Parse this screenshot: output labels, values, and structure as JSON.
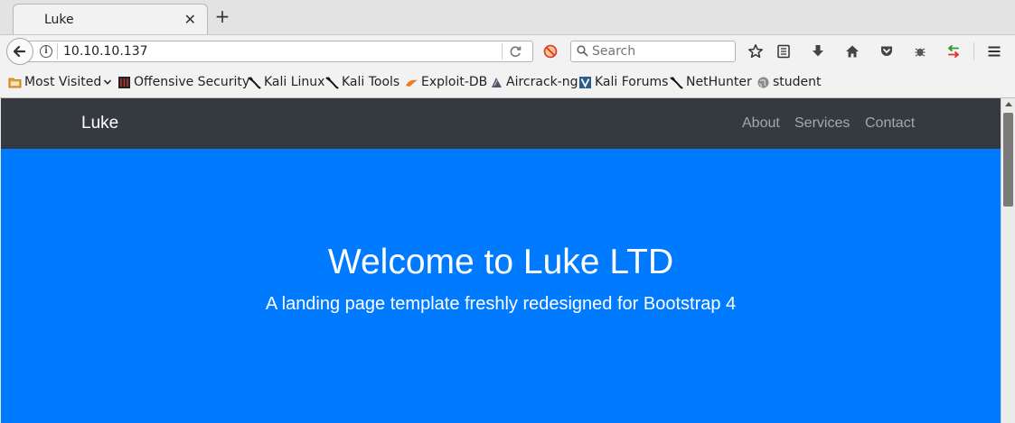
{
  "browser": {
    "tab": {
      "title": "Luke"
    },
    "url": "10.10.10.137",
    "search_placeholder": "Search"
  },
  "bookmarks": [
    {
      "label": "Most Visited",
      "icon": "folder-icon"
    },
    {
      "label": "Offensive Security",
      "icon": "offsec-icon"
    },
    {
      "label": "Kali Linux",
      "icon": "kali-dragon-icon"
    },
    {
      "label": "Kali Tools",
      "icon": "kali-dragon-icon"
    },
    {
      "label": "Exploit-DB",
      "icon": "exploitdb-icon"
    },
    {
      "label": "Aircrack-ng",
      "icon": "aircrack-icon"
    },
    {
      "label": "Kali Forums",
      "icon": "kali-forums-icon"
    },
    {
      "label": "NetHunter",
      "icon": "kali-dragon-icon"
    },
    {
      "label": "student",
      "icon": "globe-icon"
    }
  ],
  "site": {
    "brand": "Luke",
    "nav": [
      "About",
      "Services",
      "Contact"
    ],
    "hero_title": "Welcome to Luke LTD",
    "hero_subtitle": "A landing page template freshly redesigned for Bootstrap 4"
  },
  "colors": {
    "navbar": "#343a40",
    "hero": "#007bff",
    "nav_link": "rgba(255,255,255,0.55)"
  }
}
